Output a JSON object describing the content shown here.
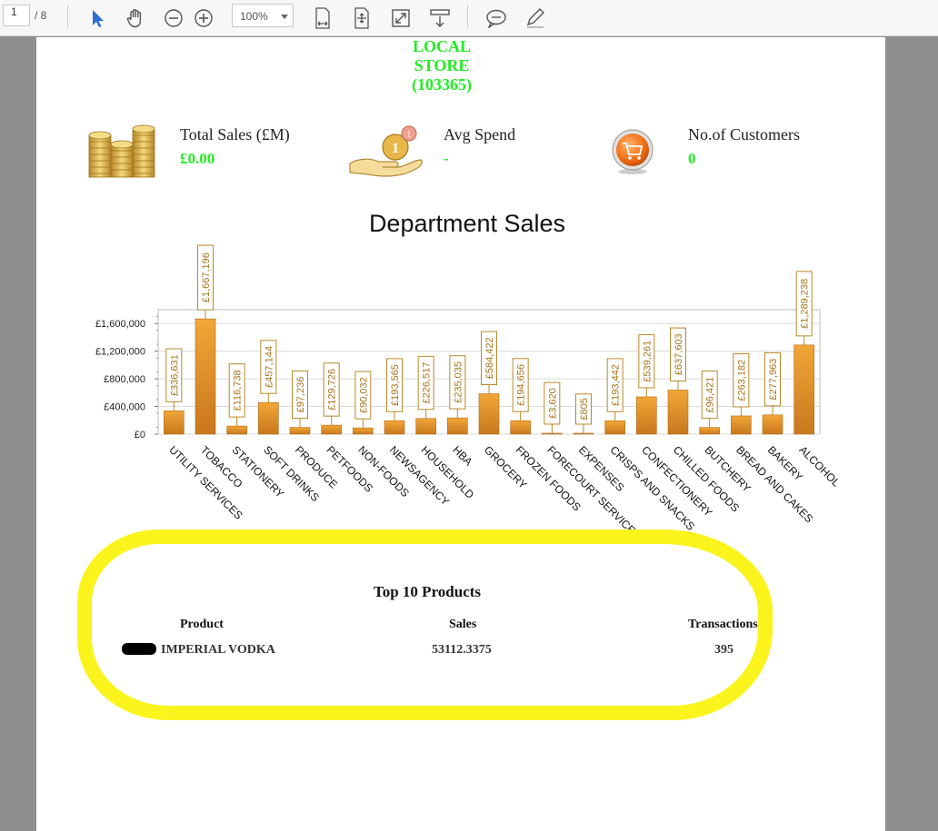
{
  "viewer": {
    "page_number": "1",
    "page_total": "/ 8",
    "zoom": "100%",
    "tool_icons": [
      "select-arrow-icon",
      "hand-icon",
      "zoom-out-icon",
      "zoom-in-icon",
      "fit-width-icon",
      "fit-page-icon",
      "fullscreen-icon",
      "scroll-mode-icon",
      "comment-icon",
      "pen-icon"
    ]
  },
  "report": {
    "store_line1": "LOCAL",
    "store_line2": "STORE",
    "store_id": "(103365)",
    "kpis": [
      {
        "label": "Total Sales (£M)",
        "value": "£0.00",
        "icon": "coins-icon"
      },
      {
        "label": "Avg Spend",
        "value": "-",
        "icon": "hand-coins-icon"
      },
      {
        "label": "No.of Customers",
        "value": "0",
        "icon": "shopping-cart-icon"
      }
    ],
    "chart_title": "Department Sales",
    "top10": {
      "title": "Top 10 Products",
      "headers": {
        "product": "Product",
        "sales": "Sales",
        "transactions": "Transactions"
      },
      "rows": [
        {
          "product": "IMPERIAL VODKA",
          "sales": "53112.3375",
          "transactions": "395"
        }
      ]
    }
  },
  "colors": {
    "accent_green": "#22ee22",
    "bar": "#e8962a",
    "highlight": "#fbf41c"
  },
  "chart_data": {
    "type": "bar",
    "title": "Department Sales",
    "categories": [
      "UTILITY SERVICES",
      "TOBACCO",
      "STATIONERY",
      "SOFT DRINKS",
      "PRODUCE",
      "PETFOODS",
      "NON-FOODS",
      "NEWSAGENCY",
      "HOUSEHOLD",
      "HBA",
      "GROCERY",
      "FROZEN FOODS",
      "FORECOURT SERVICES",
      "EXPENSES",
      "CRISPS AND SNACKS",
      "CONFECTIONERY",
      "CHILLED FOODS",
      "BUTCHERY",
      "BREAD AND CAKES",
      "BAKERY",
      "ALCOHOL"
    ],
    "values": [
      336631,
      1667196,
      116738,
      457144,
      97236,
      129726,
      90032,
      193565,
      226517,
      235035,
      584422,
      194656,
      3620,
      805,
      193442,
      539261,
      637603,
      96421,
      263182,
      277963,
      1289238
    ],
    "data_labels": [
      "£336,631",
      "£1,667,196",
      "£116,738",
      "£457,144",
      "£97,236",
      "£129,726",
      "£90,032",
      "£193,565",
      "£226,517",
      "£235,035",
      "£584,422",
      "£194,656",
      "£3,620",
      "£805",
      "£193,442",
      "£539,261",
      "£637,603",
      "£96,421",
      "£263,182",
      "£277,963",
      "£1,289,238"
    ],
    "yticks": [
      "£0",
      "£400,000",
      "£800,000",
      "£1,200,000",
      "£1,600,000"
    ],
    "ytick_values": [
      0,
      400000,
      800000,
      1200000,
      1600000
    ],
    "ylim": [
      0,
      1800000
    ],
    "grid": true,
    "legend": false
  }
}
